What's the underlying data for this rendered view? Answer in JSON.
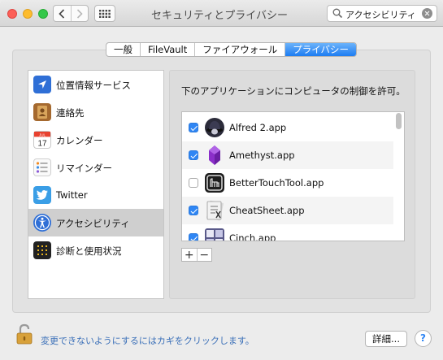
{
  "window": {
    "title": "セキュリティとプライバシー",
    "search_value": "アクセシビリティ"
  },
  "tabs": [
    {
      "label": "一般",
      "active": false
    },
    {
      "label": "FileVault",
      "active": false
    },
    {
      "label": "ファイアウォール",
      "active": false
    },
    {
      "label": "プライバシー",
      "active": true
    }
  ],
  "sidebar": {
    "items": [
      {
        "label": "位置情報サービス",
        "icon": "location-arrow-icon",
        "selected": false
      },
      {
        "label": "連絡先",
        "icon": "contacts-book-icon",
        "selected": false
      },
      {
        "label": "カレンダー",
        "icon": "calendar-icon",
        "selected": false,
        "icon_text_month": "JUL",
        "icon_text_day": "17"
      },
      {
        "label": "リマインダー",
        "icon": "reminders-list-icon",
        "selected": false
      },
      {
        "label": "Twitter",
        "icon": "twitter-bird-icon",
        "selected": false
      },
      {
        "label": "アクセシビリティ",
        "icon": "accessibility-figure-icon",
        "selected": true
      },
      {
        "label": "診断と使用状況",
        "icon": "diagnostics-grid-icon",
        "selected": false
      }
    ]
  },
  "main": {
    "prompt": "下のアプリケーションにコンピュータの制御を許可。",
    "apps": [
      {
        "name": "Alfred 2.app",
        "checked": true,
        "icon": "alfred-hat-icon"
      },
      {
        "name": "Amethyst.app",
        "checked": true,
        "icon": "amethyst-gem-icon"
      },
      {
        "name": "BetterTouchTool.app",
        "checked": false,
        "icon": "bettertouchtool-icon"
      },
      {
        "name": "CheatSheet.app",
        "checked": true,
        "icon": "cheatsheet-icon"
      },
      {
        "name": "Cinch.app",
        "checked": true,
        "icon": "cinch-grid-icon"
      }
    ],
    "add_label": "+",
    "remove_label": "−"
  },
  "footer": {
    "lock_text": "変更できないようにするにはカギをクリックします。",
    "details_label": "詳細...",
    "help_label": "?"
  },
  "colors": {
    "accent": "#1d7cf2",
    "checkbox": "#2f86f4",
    "selection": "#cfcfcf"
  }
}
